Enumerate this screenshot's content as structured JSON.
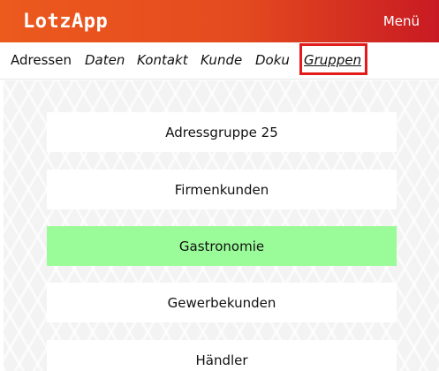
{
  "header": {
    "logo_text": "LotzApp",
    "menu_label": "Menü"
  },
  "tabs": [
    {
      "label": "Adressen",
      "style": "normal",
      "active": false
    },
    {
      "label": "Daten",
      "style": "italic",
      "active": false
    },
    {
      "label": "Kontakt",
      "style": "italic",
      "active": false
    },
    {
      "label": "Kunde",
      "style": "italic",
      "active": false
    },
    {
      "label": "Doku",
      "style": "italic",
      "active": false
    },
    {
      "label": "Gruppen",
      "style": "italic-underline",
      "active": true
    }
  ],
  "groups": [
    {
      "label": "Adressgruppe 25",
      "selected": false
    },
    {
      "label": "Firmenkunden",
      "selected": false
    },
    {
      "label": "Gastronomie",
      "selected": true
    },
    {
      "label": "Gewerbekunden",
      "selected": false
    },
    {
      "label": "Händler",
      "selected": false
    }
  ],
  "colors": {
    "header_gradient_start": "#ec5a1e",
    "header_gradient_end": "#c81a23",
    "selected_item": "#9afb99",
    "highlight_border": "#e21b1b"
  }
}
